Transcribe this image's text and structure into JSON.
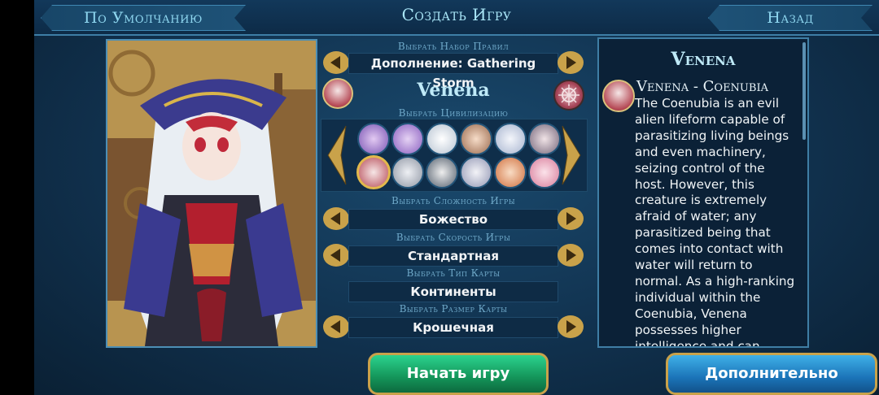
{
  "header": {
    "default_button": "По Умолчанию",
    "title": "Создать Игру",
    "back_button": "Назад"
  },
  "center": {
    "ruleset": {
      "label": "Выбрать Набор Правил",
      "value": "Дополнение: Gathering Storm"
    },
    "civilization": {
      "label": "Выбрать Цивилизацию",
      "name": "Venena"
    },
    "difficulty": {
      "label": "Выбрать Сложность Игры",
      "value": "Божество"
    },
    "speed": {
      "label": "Выбрать Скорость Игры",
      "value": "Стандартная"
    },
    "map_type": {
      "label": "Выбрать Тип Карты",
      "value": "Континенты"
    },
    "map_size": {
      "label": "Выбрать Размер Карты",
      "value": "Крошечная"
    }
  },
  "description": {
    "title": "Venena",
    "subtitle": "Venena - Coenubia",
    "body": "The Coenubia is an evil alien lifeform capable of parasitizing living beings and even machinery, seizing control of the host. However, this creature is extremely afraid of water; any parasitized being that comes into contact with water will return to normal. As a high-ranking individual within the Coenubia, Venena possesses higher intelligence and can"
  },
  "buttons": {
    "start": "Начать игру",
    "more": "Дополнительно"
  },
  "colors": {
    "accent_gold": "#c9a24a",
    "start_green": "#149459",
    "more_blue": "#1b74b8"
  },
  "icons": [
    "arrow-left-icon",
    "arrow-right-icon",
    "venena-emblem-icon",
    "random-civ-icon",
    "civ-avatar"
  ]
}
